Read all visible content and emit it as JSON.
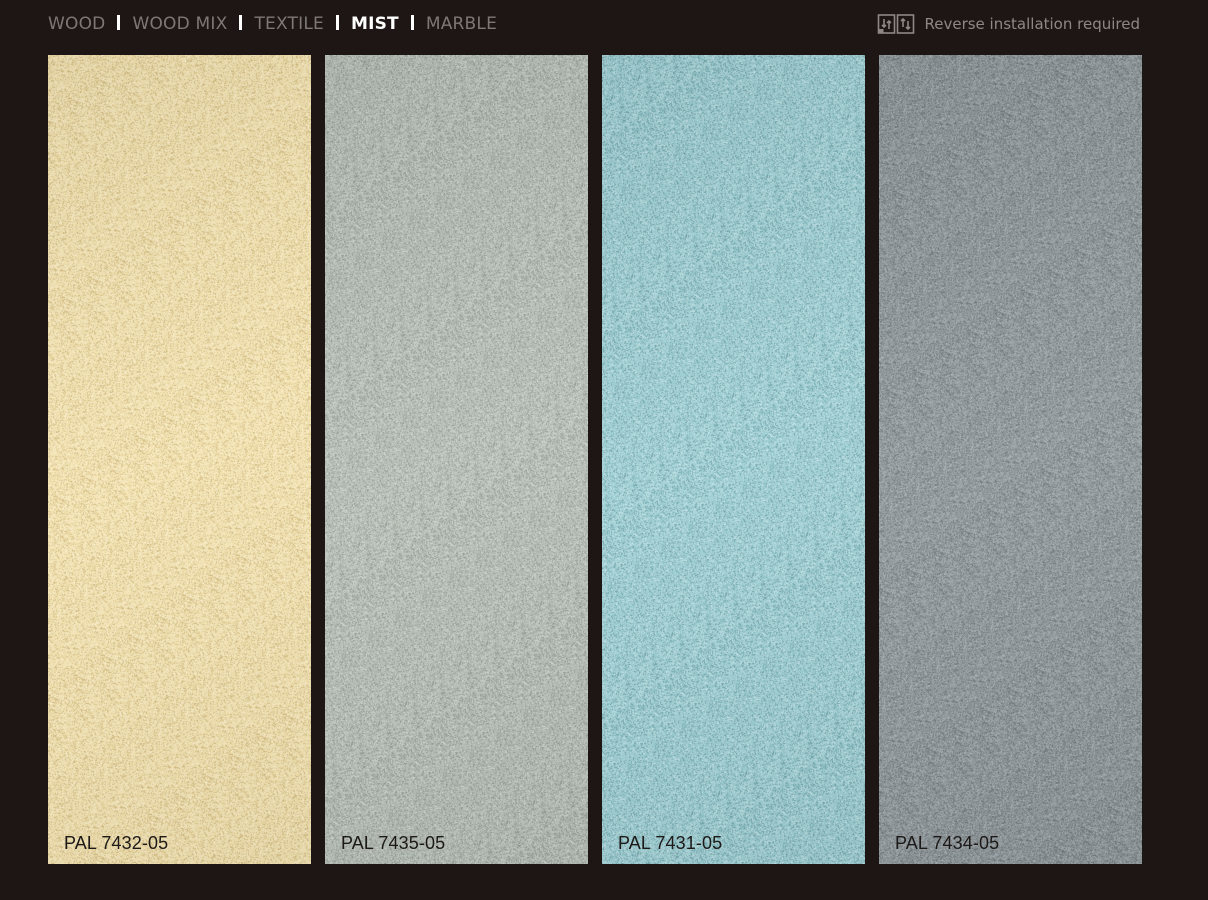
{
  "nav": {
    "tabs": [
      {
        "label": "WOOD",
        "active": false
      },
      {
        "label": "WOOD MIX",
        "active": false
      },
      {
        "label": "TEXTILE",
        "active": false
      },
      {
        "label": "MIST",
        "active": true
      },
      {
        "label": "MARBLE",
        "active": false
      }
    ]
  },
  "notice": {
    "icon": "reverse-installation-icon",
    "text": "Reverse installation required"
  },
  "swatches": [
    {
      "code": "PAL 7432-05",
      "color": "#f2e1ae",
      "speckle_dark": "#cdb57a",
      "speckle_light": "#fbf0cf"
    },
    {
      "code": "PAL 7435-05",
      "color": "#b4bcb4",
      "speckle_dark": "#8d968f",
      "speckle_light": "#d4dad3"
    },
    {
      "code": "PAL 7431-05",
      "color": "#9ccdd2",
      "speckle_dark": "#6a9ea4",
      "speckle_light": "#c7e6e8"
    },
    {
      "code": "PAL 7434-05",
      "color": "#8e969a",
      "speckle_dark": "#6a7276",
      "speckle_light": "#b0b7ba"
    }
  ]
}
